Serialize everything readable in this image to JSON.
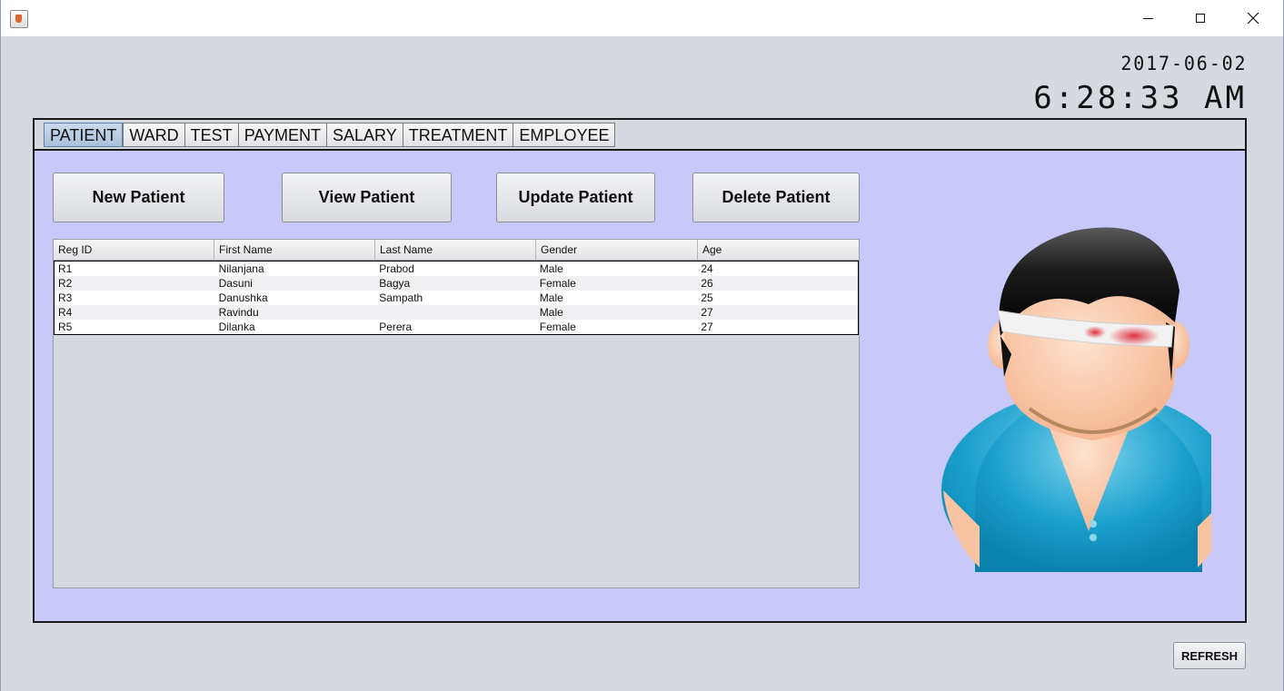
{
  "window": {
    "controls": [
      "minimize",
      "maximize",
      "close"
    ]
  },
  "clock": {
    "date": "2017-06-02",
    "time": "6:28:33 AM"
  },
  "tabs": [
    {
      "label": "PATIENT",
      "active": true
    },
    {
      "label": "WARD",
      "active": false
    },
    {
      "label": "TEST",
      "active": false
    },
    {
      "label": "PAYMENT",
      "active": false
    },
    {
      "label": "SALARY",
      "active": false
    },
    {
      "label": "TREATMENT",
      "active": false
    },
    {
      "label": "EMPLOYEE",
      "active": false
    }
  ],
  "actions": {
    "new": "New Patient",
    "view": "View Patient",
    "update": "Update Patient",
    "delete": "Delete Patient"
  },
  "table": {
    "columns": [
      "Reg ID",
      "First Name",
      "Last Name",
      "Gender",
      "Age"
    ],
    "rows": [
      [
        "R1",
        "Nilanjana",
        "Prabod",
        "Male",
        "24"
      ],
      [
        "R2",
        "Dasuni",
        "Bagya",
        "Female",
        "26"
      ],
      [
        "R3",
        "Danushka",
        "Sampath",
        "Male",
        "25"
      ],
      [
        "R4",
        "Ravindu",
        "",
        "Male",
        "27"
      ],
      [
        "R5",
        "Dilanka",
        "Perera",
        "Female",
        "27"
      ]
    ]
  },
  "refresh_label": "REFRESH",
  "colors": {
    "panel_bg": "#c8c9f9",
    "window_bg": "#d6d9e0",
    "active_tab": "#b4c8e2"
  },
  "icons": {
    "app": "java-coffee-cup-icon",
    "illustration": "injured-patient-avatar"
  }
}
